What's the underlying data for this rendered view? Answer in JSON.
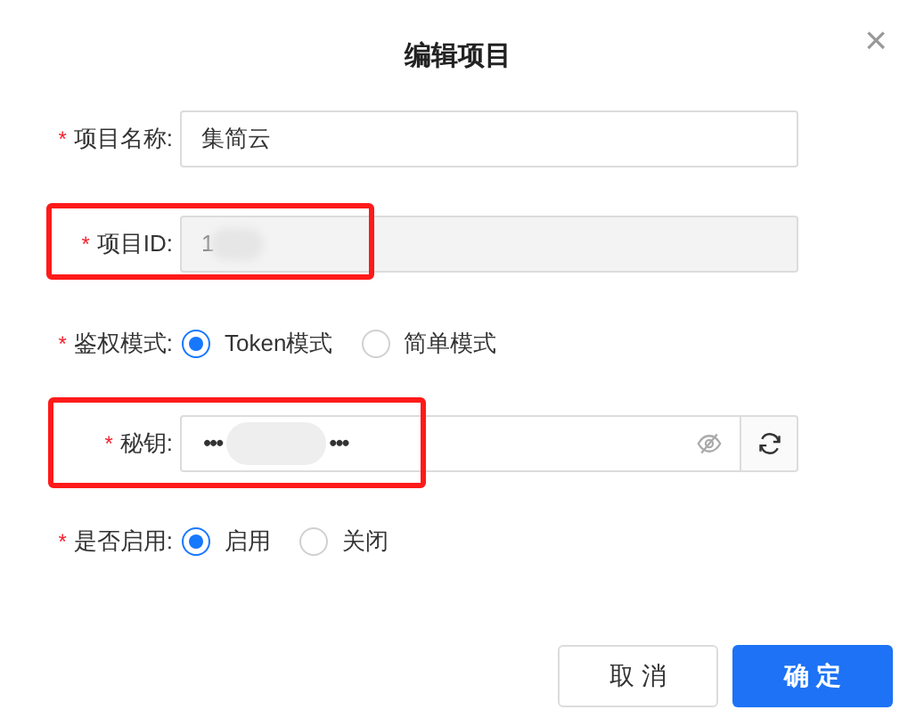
{
  "dialog": {
    "title": "编辑项目",
    "close": "×"
  },
  "fields": [
    {
      "kind": "text",
      "label": "项目名称:",
      "required_mark": "*",
      "value": "集简云",
      "disabled": false,
      "highlighted": false
    },
    {
      "kind": "text",
      "label": "项目ID:",
      "required_mark": "*",
      "value": "1",
      "disabled": true,
      "highlighted": true
    },
    {
      "kind": "radio",
      "label": "鉴权模式:",
      "required_mark": "*",
      "options": [
        {
          "label": "Token模式",
          "selected": true
        },
        {
          "label": "简单模式",
          "selected": false
        }
      ]
    },
    {
      "kind": "secret",
      "label": "秘钥:",
      "required_mark": "*",
      "value_parts": [
        "•••",
        "•••"
      ],
      "highlighted": true
    },
    {
      "kind": "radio",
      "label": "是否启用:",
      "required_mark": "*",
      "options": [
        {
          "label": "启用",
          "selected": true
        },
        {
          "label": "关闭",
          "selected": false
        }
      ]
    }
  ],
  "buttons": [
    {
      "label": "取 消",
      "primary": false
    },
    {
      "label": "确 定",
      "primary": true
    }
  ]
}
